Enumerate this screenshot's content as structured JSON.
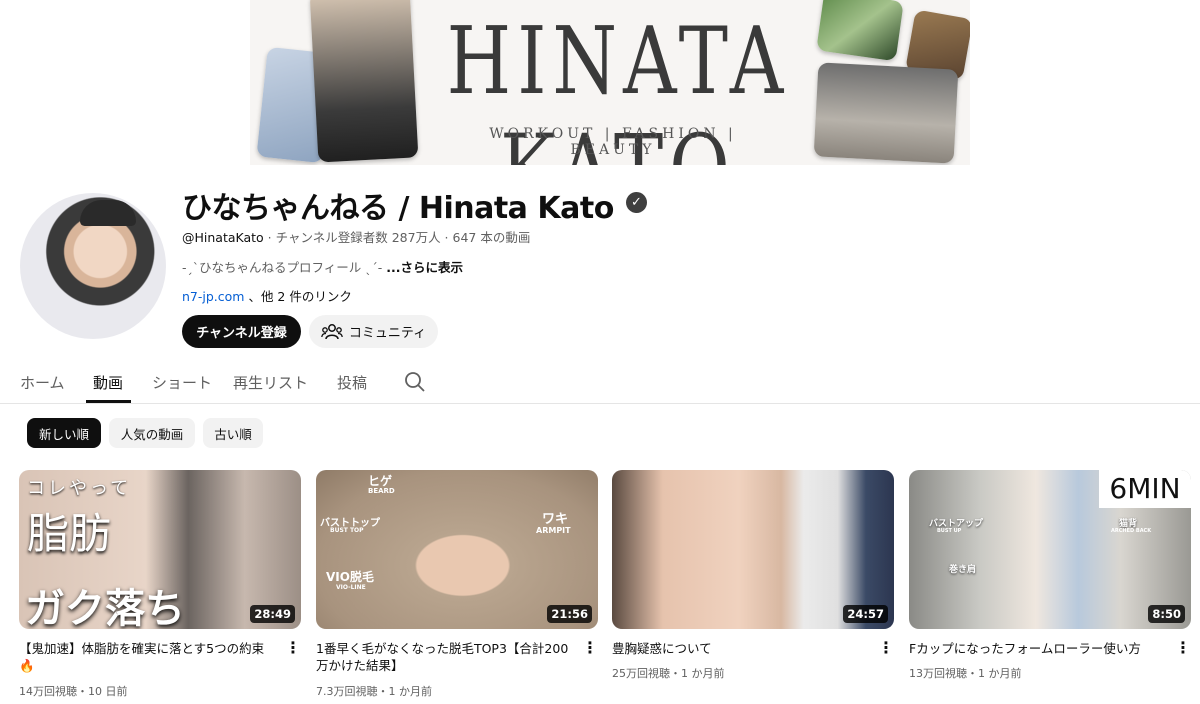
{
  "banner": {
    "title": "HINATA KATO",
    "subtitle": "WORKOUT | FASHION | BEAUTY"
  },
  "channel": {
    "name": "ひなちゃんねる / Hinata Kato",
    "handle": "@HinataKato",
    "stats": " · チャンネル登録者数 287万人 · 647 本の動画",
    "description": "-ˏˋひなちゃんねるプロフィール ˎˊ- ",
    "more_label": "...さらに表示",
    "link_text": "n7-jp.com",
    "link_suffix": " 、他 2 件のリンク",
    "subscribe_label": "チャンネル登録",
    "community_label": "コミュニティ"
  },
  "tabs": [
    {
      "label": "ホーム"
    },
    {
      "label": "動画"
    },
    {
      "label": "ショート"
    },
    {
      "label": "再生リスト"
    },
    {
      "label": "投稿"
    }
  ],
  "active_tab": "動画",
  "chips": [
    {
      "label": "新しい順"
    },
    {
      "label": "人気の動画"
    },
    {
      "label": "古い順"
    }
  ],
  "videos": [
    {
      "title": "【鬼加速】体脂肪を確実に落とす5つの約束🔥",
      "meta": "14万回視聴・10 日前",
      "duration": "28:49",
      "thumb_texts": [
        "コレやって",
        "脂肪",
        "ガク落ち"
      ]
    },
    {
      "title": "1番早く毛がなくなった脱毛TOP3【合計200万かけた結果】",
      "meta": "7.3万回視聴・1 か月前",
      "duration": "21:56",
      "thumb_texts": [
        "ヒゲ",
        "BEARD",
        "バストトップ",
        "BUST TOP",
        "ワキ",
        "ARMPIT",
        "VIO脱毛",
        "VIO-LINE"
      ]
    },
    {
      "title": "豊胸疑惑について",
      "meta": "25万回視聴・1 か月前",
      "duration": "24:57",
      "thumb_texts": []
    },
    {
      "title": "Fカップになったフォームローラー使い方",
      "meta": "13万回視聴・1 か月前",
      "duration": "8:50",
      "thumb_texts": [
        "6MIN",
        "バストアップ",
        "BUST UP",
        "猫背",
        "ARCHED BACK",
        "巻き肩"
      ]
    }
  ],
  "colors": {
    "text_primary": "#0f0f0f",
    "text_secondary": "#606060",
    "link": "#065fd4",
    "chip_bg": "#f2f2f2"
  }
}
